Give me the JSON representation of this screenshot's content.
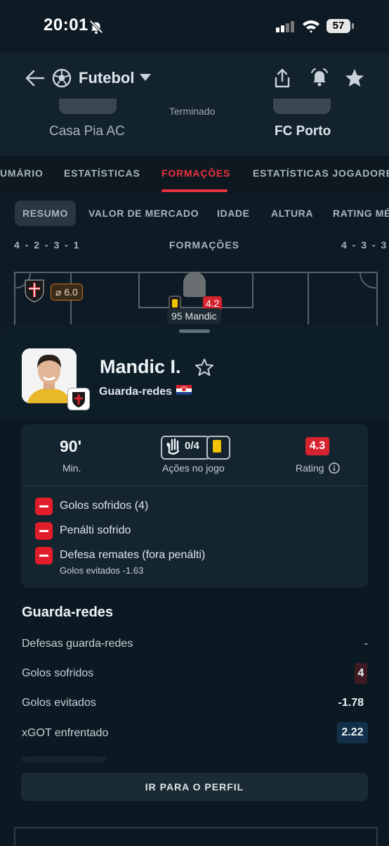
{
  "status_bar": {
    "time": "20:01",
    "battery": "57"
  },
  "header": {
    "sport": "Futebol"
  },
  "match": {
    "home_team": "Casa Pia AC",
    "away_team": "FC Porto",
    "status": "Terminado"
  },
  "tabs": [
    {
      "label": "UMÁRIO",
      "active": false
    },
    {
      "label": "ESTATÍSTICAS",
      "active": false
    },
    {
      "label": "FORMAÇÕES",
      "active": true
    },
    {
      "label": "ESTATÍSTICAS JOGADORES",
      "active": false
    }
  ],
  "chips": [
    {
      "label": "RESUMO",
      "active": true
    },
    {
      "label": "VALOR DE MERCADO",
      "active": false
    },
    {
      "label": "IDADE",
      "active": false
    },
    {
      "label": "ALTURA",
      "active": false
    },
    {
      "label": "RATING MÉ",
      "active": false
    }
  ],
  "formation": {
    "home": "4 - 2 - 3 - 1",
    "title": "FORMAÇÕES",
    "away": "4 - 3 - 3"
  },
  "pitch": {
    "avg_rating": "6.0",
    "player_rating": "4.2",
    "player_label": "95 Mandic"
  },
  "player": {
    "name": "Mandic I.",
    "position": "Guarda-redes",
    "minutes": "90'",
    "minutes_label": "Min.",
    "actions": "0/4",
    "actions_label": "Ações no jogo",
    "rating": "4.3",
    "rating_label": "Rating"
  },
  "events": [
    {
      "text": "Golos sofridos (4)"
    },
    {
      "text": "Penálti sofrido"
    },
    {
      "text": "Defesa remates (fora penálti)",
      "sub": "Golos evitados -1.63"
    }
  ],
  "goalkeeper": {
    "title": "Guarda-redes",
    "rows": [
      {
        "label": "Defesas guarda-redes",
        "value": "-"
      },
      {
        "label": "Golos sofridos",
        "value": "4"
      },
      {
        "label": "Golos evitados",
        "value": "-1.78"
      },
      {
        "label": "xGOT enfrentado",
        "value": "2.22"
      }
    ]
  },
  "profile_button": "IR PARA O PERFIL",
  "colors": {
    "accent": "#e8323f",
    "rating_bad": "#d6242f",
    "yellow_card": "#f2c200",
    "background": "#0f1b24"
  }
}
